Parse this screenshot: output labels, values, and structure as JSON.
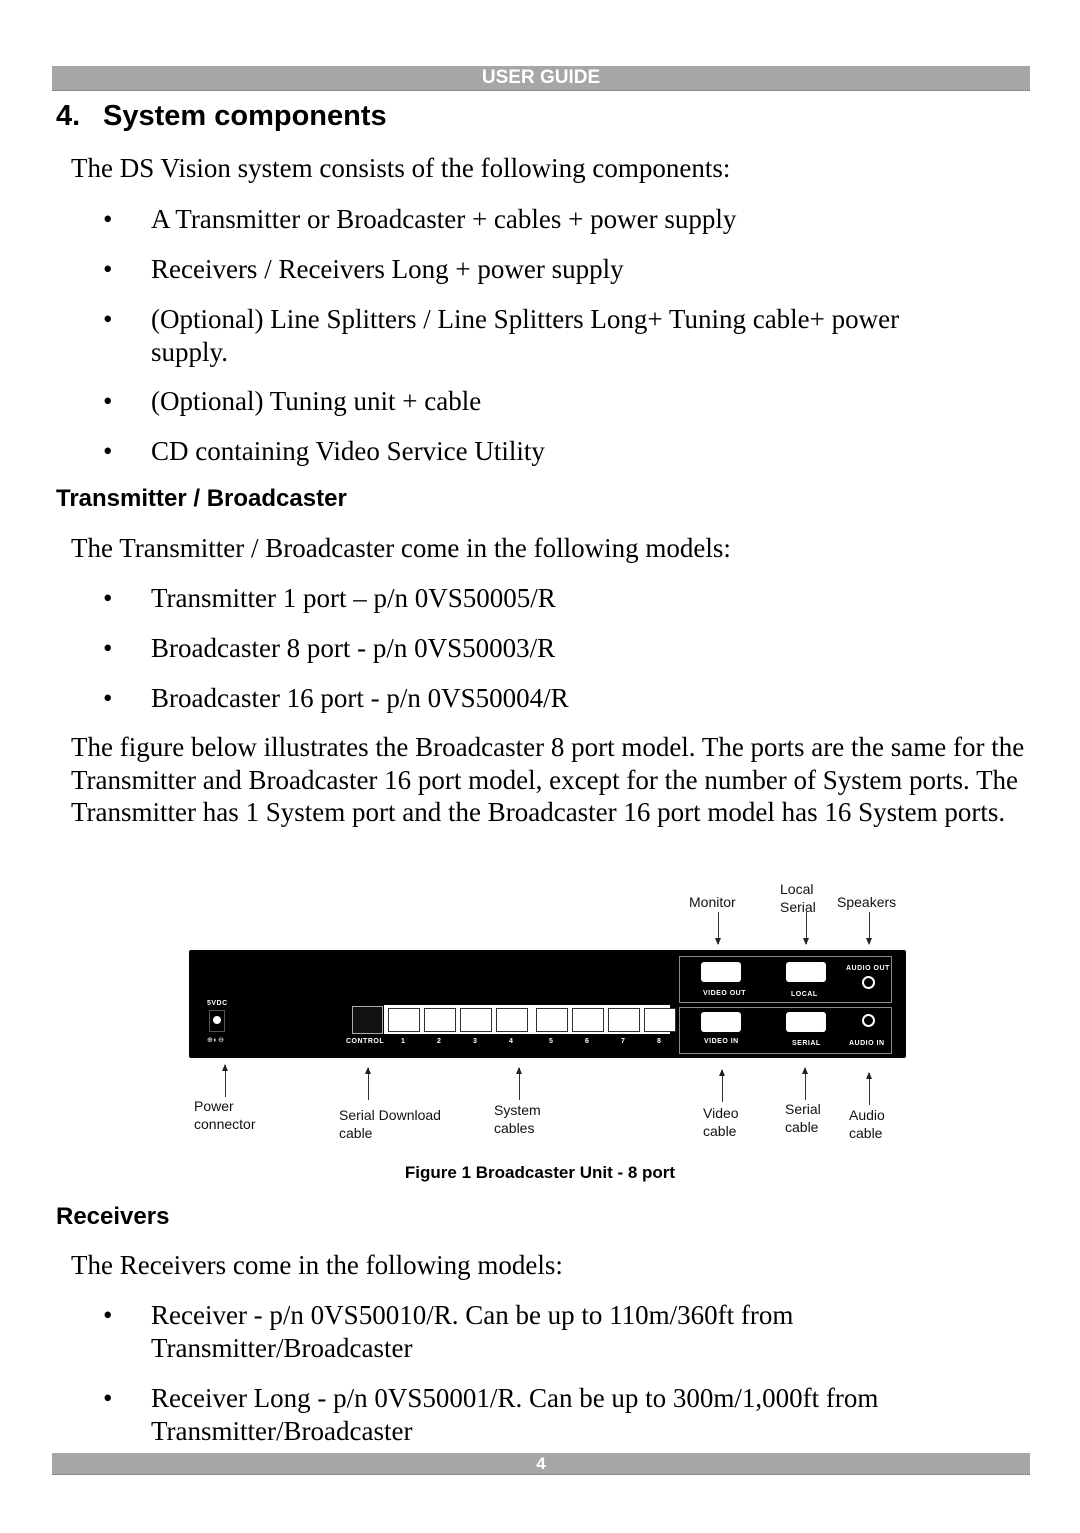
{
  "header": {
    "title": "USER GUIDE"
  },
  "footer": {
    "page_number": "4"
  },
  "section": {
    "number": "4.",
    "title": "System components",
    "intro": "The DS Vision system consists of the following components:",
    "components": [
      "A Transmitter or Broadcaster + cables + power supply",
      "Receivers / Receivers Long + power supply",
      "(Optional) Line Splitters / Line Splitters Long+ Tuning cable+ power supply.",
      "(Optional) Tuning unit + cable",
      "CD containing Video Service Utility"
    ]
  },
  "transmitter": {
    "heading": "Transmitter / Broadcaster",
    "intro": "The Transmitter / Broadcaster come in the following models:",
    "models": [
      "Transmitter 1 port – p/n 0VS50005/R",
      "Broadcaster 8 port - p/n 0VS50003/R",
      "Broadcaster 16 port - p/n 0VS50004/R"
    ],
    "description": "The figure below illustrates the Broadcaster 8 port model. The ports are the same for the Transmitter and Broadcaster 16 port model, except for the number of System ports. The Transmitter has 1 System port and the Broadcaster 16 port model has 16 System ports."
  },
  "figure": {
    "caption": "Figure 1 Broadcaster Unit - 8 port",
    "top_labels": {
      "monitor": "Monitor",
      "local_serial": "Local Serial",
      "speakers": "Speakers"
    },
    "bottom_labels": {
      "power": "Power connector",
      "serial_download": "Serial Download cable",
      "system": "System cables",
      "video": "Video cable",
      "serial": "Serial cable",
      "audio": "Audio cable"
    },
    "panel": {
      "power": "5VDC",
      "polarity": "⊕◐⊖",
      "control": "CONTROL",
      "ports": [
        "1",
        "2",
        "3",
        "4",
        "5",
        "6",
        "7",
        "8"
      ],
      "video_out": "VIDEO OUT",
      "local": "LOCAL",
      "audio_out": "AUDIO OUT",
      "video_in": "VIDEO IN",
      "serial": "SERIAL",
      "audio_in": "AUDIO IN"
    }
  },
  "receivers": {
    "heading": "Receivers",
    "intro": "The Receivers come in the following models:",
    "models": [
      "Receiver - p/n 0VS50010/R. Can be up to 110m/360ft from Transmitter/Broadcaster",
      "Receiver Long - p/n 0VS50001/R. Can be up to 300m/1,000ft from Transmitter/Broadcaster"
    ]
  }
}
